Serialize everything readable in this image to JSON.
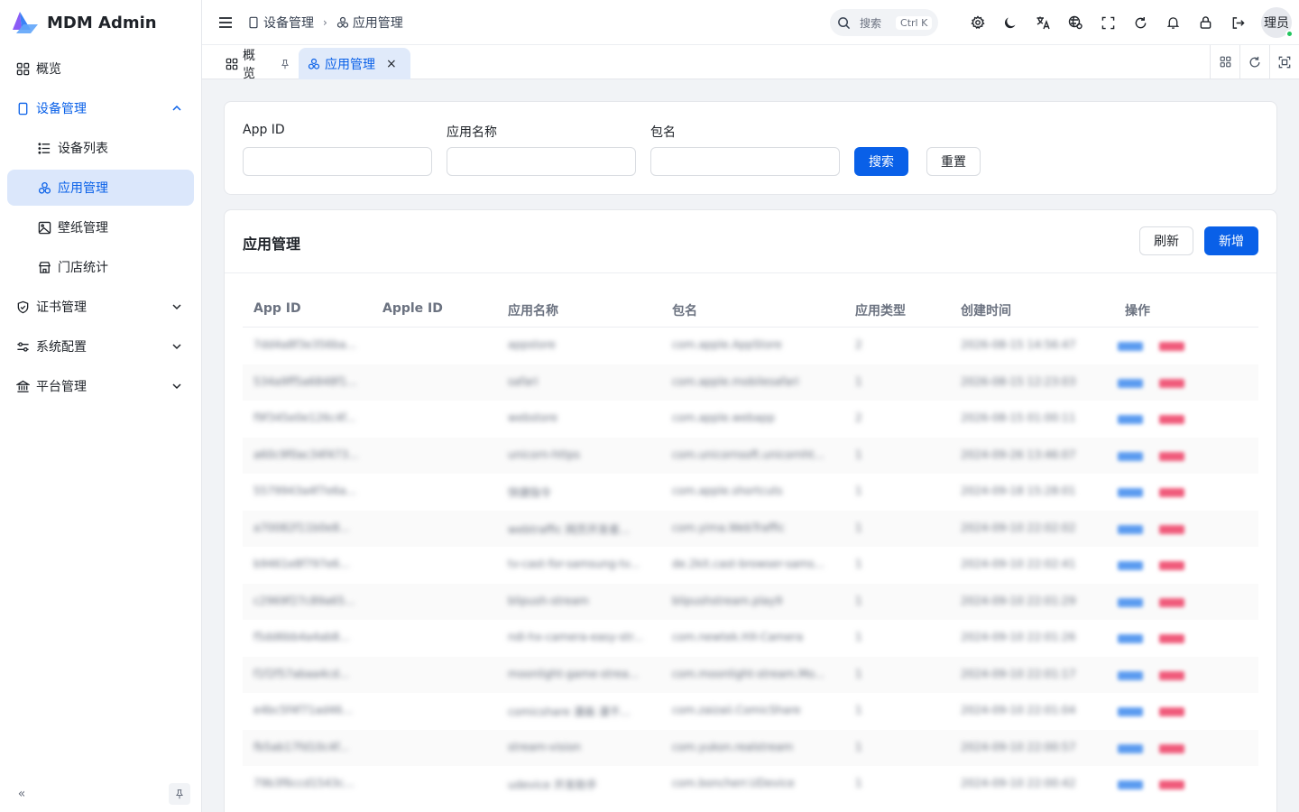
{
  "brand": {
    "title": "MDM Admin"
  },
  "sidebar": {
    "items": [
      {
        "label": "概览",
        "icon": "dashboard-icon"
      },
      {
        "label": "设备管理",
        "icon": "phone-icon"
      },
      {
        "label": "设备列表",
        "icon": "list-icon"
      },
      {
        "label": "应用管理",
        "icon": "apps-icon"
      },
      {
        "label": "壁纸管理",
        "icon": "image-icon"
      },
      {
        "label": "门店统计",
        "icon": "store-icon"
      },
      {
        "label": "证书管理",
        "icon": "shield-icon"
      },
      {
        "label": "系统配置",
        "icon": "settings-sliders-icon"
      },
      {
        "label": "平台管理",
        "icon": "bank-icon"
      }
    ]
  },
  "header": {
    "breadcrumb": [
      "设备管理",
      "应用管理"
    ],
    "search_label": "搜索",
    "search_shortcut": "Ctrl K",
    "user_name": "理员"
  },
  "tabs": [
    {
      "label": "概览"
    },
    {
      "label": "应用管理"
    }
  ],
  "filter": {
    "fields": [
      {
        "label": "App ID",
        "value": ""
      },
      {
        "label": "应用名称",
        "value": ""
      },
      {
        "label": "包名",
        "value": ""
      }
    ],
    "search_label": "搜索",
    "reset_label": "重置"
  },
  "table": {
    "title": "应用管理",
    "refresh_label": "刷新",
    "add_label": "新增",
    "columns": [
      "App ID",
      "Apple ID",
      "应用名称",
      "包名",
      "应用类型",
      "创建时间",
      "操作"
    ],
    "actions": {
      "edit": "编辑",
      "delete": "删除"
    },
    "rows": [
      [
        "7dd4a8f3e356ba...",
        "",
        "appstore",
        "com.apple.AppStore",
        "2",
        "2026-08-15 14:56:47"
      ],
      [
        "534a9ff5a6848f1...",
        "",
        "safari",
        "com.apple.mobilesafari",
        "1",
        "2026-08-15 12:23:03"
      ],
      [
        "f9f345e0e126c4f...",
        "",
        "webstore",
        "com.apple.webapp",
        "2",
        "2026-08-15 01:00:11"
      ],
      [
        "a60c9f0ac34f473...",
        "",
        "unicorn-https",
        "com.unicornsoft.unicornht...",
        "1",
        "2024-09-26 13:46:07"
      ],
      [
        "5579943a4f7e6a...",
        "",
        "快捷指令",
        "com.apple.shortcuts",
        "1",
        "2024-09-18 15:28:01"
      ],
      [
        "a70082f11b0e8...",
        "",
        "webtraffic 网页开发者...",
        "com.yima.WebTraffic",
        "1",
        "2024-09-10 22:02:02"
      ],
      [
        "b9461e8f797e6...",
        "",
        "tv-cast-for-samsung-tv...",
        "de.2kit.cast-browser-sams...",
        "1",
        "2024-09-10 22:02:41"
      ],
      [
        "c2969f27c89a65...",
        "",
        "blipush-stream",
        "blipushstream.play9",
        "1",
        "2024-09-10 22:01:29"
      ],
      [
        "f5dd6bb4a4ab8...",
        "",
        "ndi-hx-camera-easy-str...",
        "com.newtek.HX-Camera",
        "1",
        "2024-09-10 22:01:26"
      ],
      [
        "f1f2f57abaa4cd...",
        "",
        "moonlight-game-strea...",
        "com.moonlight-stream.Mo...",
        "1",
        "2024-09-10 22:01:17"
      ],
      [
        "e4bc5f4f71ad46...",
        "",
        "comicshare 漫画 漫不...",
        "com.zaizaii.ComicShare",
        "1",
        "2024-09-10 22:01:04"
      ],
      [
        "fb5ab17fd10c4f...",
        "",
        "stream-vision",
        "com.yukon.realstream",
        "1",
        "2024-09-10 22:00:57"
      ],
      [
        "79b3f6ccd1543c...",
        "",
        "udevice 开发助手",
        "com.boncherr.UDevice",
        "1",
        "2024-09-10 22:00:42"
      ]
    ]
  }
}
